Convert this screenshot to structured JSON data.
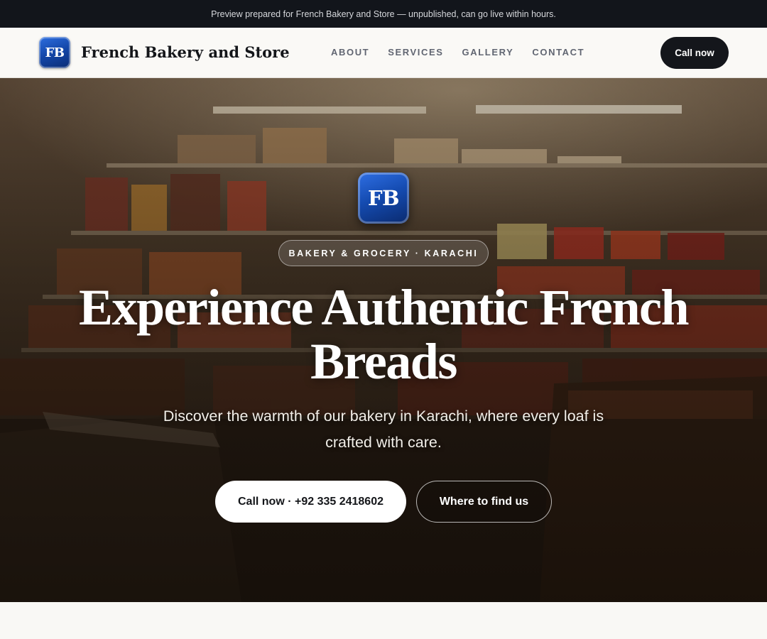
{
  "announcement": {
    "text": "Preview prepared for French Bakery and Store — unpublished, can go live within hours."
  },
  "header": {
    "logo_initials": "FB",
    "brand_name": "French Bakery and Store",
    "nav": [
      {
        "label": "ABOUT"
      },
      {
        "label": "SERVICES"
      },
      {
        "label": "GALLERY"
      },
      {
        "label": "CONTACT"
      }
    ],
    "cta_label": "Call now"
  },
  "hero": {
    "logo_initials": "FB",
    "eyebrow": "BAKERY & GROCERY · KARACHI",
    "title": "Experience Authentic French Breads",
    "subtitle": "Discover the warmth of our bakery in Karachi, where every loaf is crafted with care.",
    "primary_button": "Call now · +92 335 2418602",
    "secondary_button": "Where to find us"
  },
  "colors": {
    "brand_blue": "#1346a8",
    "dark": "#14161b",
    "topbar": "#12151b",
    "page_bg": "#f9f8f5"
  }
}
